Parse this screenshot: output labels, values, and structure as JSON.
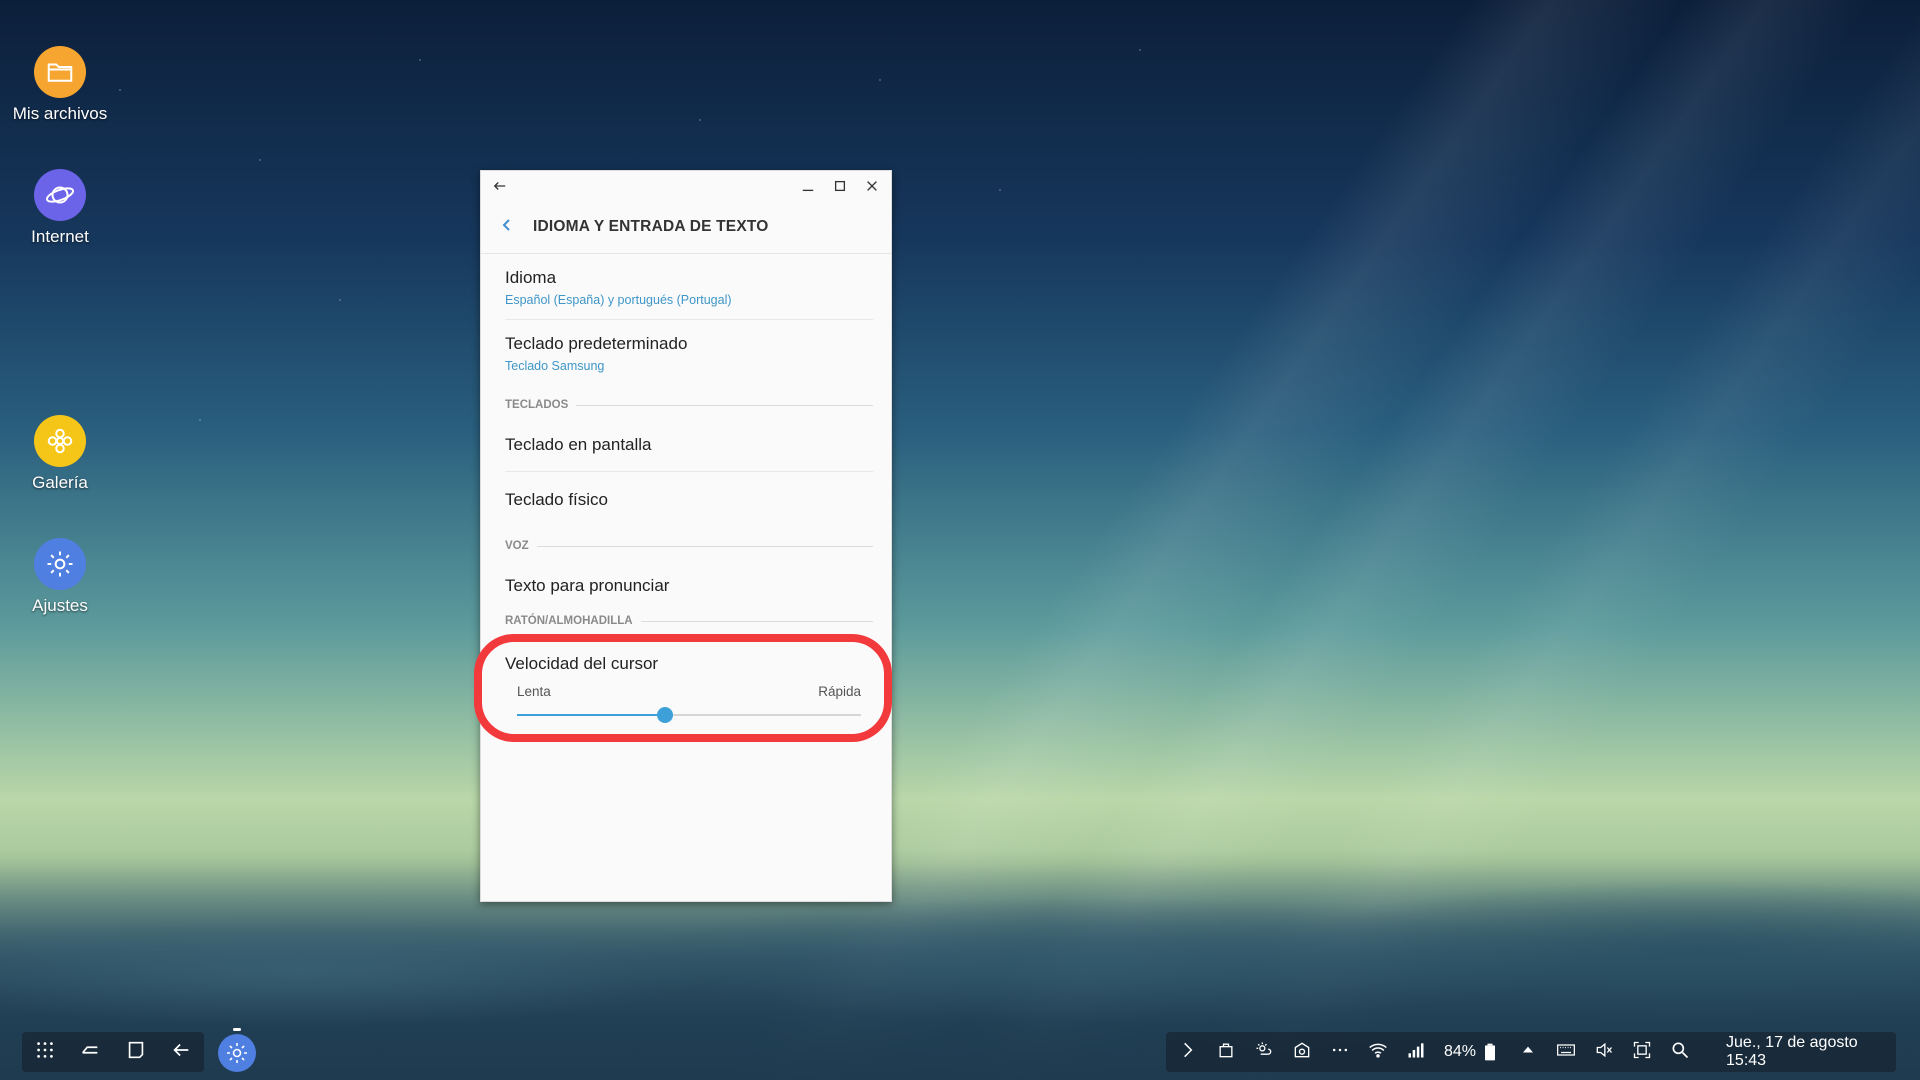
{
  "desktop": {
    "icons": [
      {
        "label": "Mis archivos",
        "icon": "folder-icon",
        "color": "#f7a531"
      },
      {
        "label": "Internet",
        "icon": "planet-icon",
        "color": "#6b63e8"
      },
      {
        "label": "Galería",
        "icon": "flower-icon",
        "color": "#f5c518"
      },
      {
        "label": "Ajustes",
        "icon": "gear-icon",
        "color": "#4f7fe0"
      }
    ]
  },
  "window": {
    "header_title": "IDIOMA Y ENTRADA DE TEXTO",
    "items": {
      "idioma": {
        "title": "Idioma",
        "subtitle": "Español (España) y portugués (Portugal)"
      },
      "teclado_pred": {
        "title": "Teclado predeterminado",
        "subtitle": "Teclado Samsung"
      }
    },
    "sections": {
      "teclados": "TECLADOS",
      "voz": "VOZ",
      "raton": "RATÓN/ALMOHADILLA"
    },
    "teclado_pantalla": "Teclado en pantalla",
    "teclado_fisico": "Teclado físico",
    "texto_pronunciar": "Texto para pronunciar",
    "cursor": {
      "title": "Velocidad del cursor",
      "min_label": "Lenta",
      "max_label": "Rápida",
      "value_fraction": 0.43
    }
  },
  "taskbar": {
    "battery": "84%",
    "datetime": "Jue., 17 de agosto 15:43"
  }
}
